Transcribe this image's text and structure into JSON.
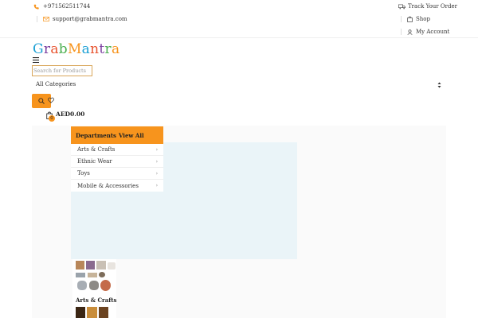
{
  "topbar": {
    "phone": "+971562511744",
    "email": "support@grabmantra.com",
    "links": [
      "Track Your Order",
      "Shop",
      "My Account"
    ]
  },
  "logo": {
    "letters": [
      "G",
      "r",
      "a",
      "b",
      "M",
      "a",
      "n",
      "t",
      "r",
      "a"
    ],
    "colors": [
      "#1a9fd4",
      "#7b3fa0",
      "#e8542f",
      "#4caf50",
      "#f7941d",
      "#1a9fd4",
      "#e8542f",
      "#7b3fa0",
      "#4caf50",
      "#f7941d"
    ]
  },
  "search": {
    "placeholder": "Search for Products",
    "category_selected": "All Categories"
  },
  "cart": {
    "amount": "AED0.00",
    "count": "0"
  },
  "departments": {
    "title": "Departments",
    "view_all": "View All",
    "items": [
      "Arts & Crafts",
      "Ethnic Wear",
      "Toys",
      "Mobile & Accessories"
    ]
  },
  "featured": {
    "label": "Arts & Crafts"
  },
  "colors": {
    "accent": "#f7941d",
    "hero_bg": "#eaf4f8"
  },
  "icons": [
    "phone-icon",
    "mail-icon",
    "truck-icon",
    "bag-icon",
    "user-icon",
    "menu-icon",
    "search-icon",
    "heart-icon",
    "cart-icon",
    "chevron-right-icon",
    "chevron-updown-icon"
  ]
}
